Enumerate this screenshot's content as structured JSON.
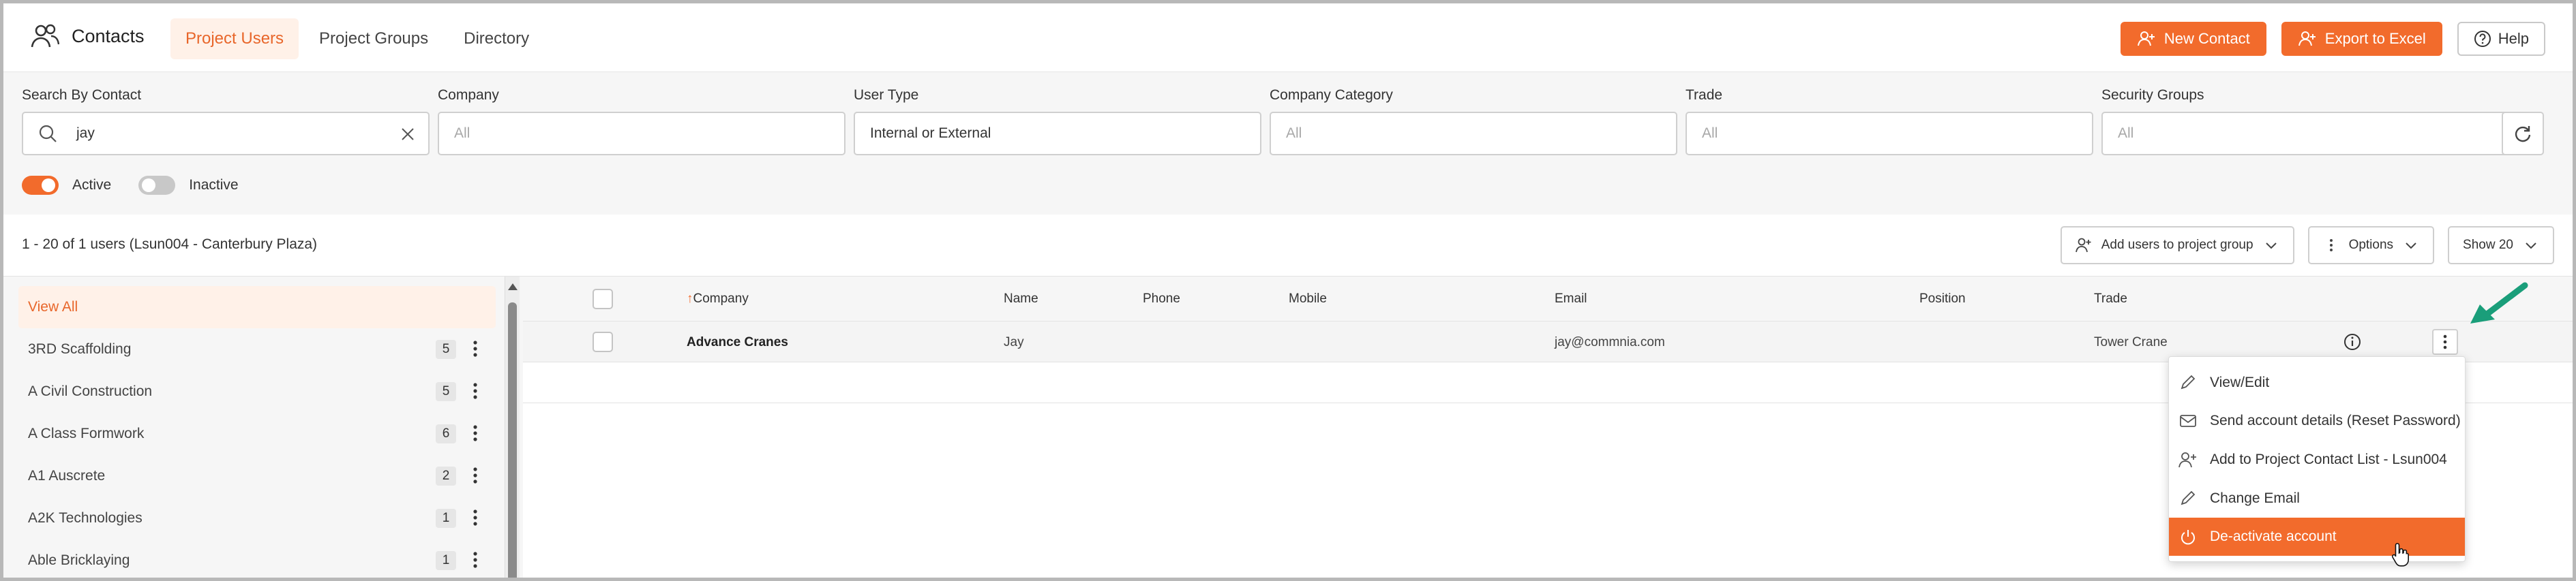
{
  "app": {
    "title": "Contacts"
  },
  "tabs": [
    {
      "label": "Project Users",
      "active": true
    },
    {
      "label": "Project Groups",
      "active": false
    },
    {
      "label": "Directory",
      "active": false
    }
  ],
  "header_actions": {
    "new_contact": "New Contact",
    "export_excel": "Export to Excel",
    "help": "Help"
  },
  "filters": {
    "search": {
      "label": "Search By Contact",
      "value": "jay"
    },
    "company": {
      "label": "Company",
      "placeholder": "All"
    },
    "user_type": {
      "label": "User Type",
      "value": "Internal or External"
    },
    "company_category": {
      "label": "Company Category",
      "placeholder": "All"
    },
    "trade": {
      "label": "Trade",
      "placeholder": "All"
    },
    "security_groups": {
      "label": "Security Groups",
      "placeholder": "All"
    }
  },
  "toggles": {
    "active": {
      "label": "Active",
      "on": true
    },
    "inactive": {
      "label": "Inactive",
      "on": false
    }
  },
  "results": {
    "count_text": "1 - 20 of 1 users (Lsun004 - Canterbury Plaza)",
    "add_group": "Add users to project group",
    "options": "Options",
    "show": "Show 20"
  },
  "sidebar": {
    "items": [
      {
        "label": "View All",
        "active": true
      },
      {
        "label": "3RD Scaffolding",
        "count": "5"
      },
      {
        "label": "A Civil Construction",
        "count": "5"
      },
      {
        "label": "A Class Formwork",
        "count": "6"
      },
      {
        "label": "A1 Auscrete",
        "count": "2"
      },
      {
        "label": "A2K Technologies",
        "count": "1"
      },
      {
        "label": "Able Bricklaying",
        "count": "1"
      }
    ]
  },
  "table": {
    "columns": [
      "Company",
      "Name",
      "Phone",
      "Mobile",
      "Email",
      "Position",
      "Trade"
    ],
    "sort_indicator": "↑",
    "rows": [
      {
        "company": "Advance Cranes",
        "name": "Jay",
        "phone": "",
        "mobile": "",
        "email": "jay@commnia.com",
        "position": "",
        "trade": "Tower Crane"
      }
    ]
  },
  "row_menu": {
    "items": [
      {
        "label": "View/Edit",
        "icon": "pencil-icon"
      },
      {
        "label": "Send account details (Reset Password)",
        "icon": "envelope-icon"
      },
      {
        "label": "Add to Project Contact List - Lsun004",
        "icon": "add-user-icon"
      },
      {
        "label": "Change Email",
        "icon": "pencil-icon"
      },
      {
        "label": "De-activate account",
        "icon": "power-icon",
        "highlighted": true
      }
    ]
  },
  "colors": {
    "accent": "#f26b2c",
    "accent_light": "#fff1e8",
    "annotation_arrow": "#1a9e7a"
  }
}
